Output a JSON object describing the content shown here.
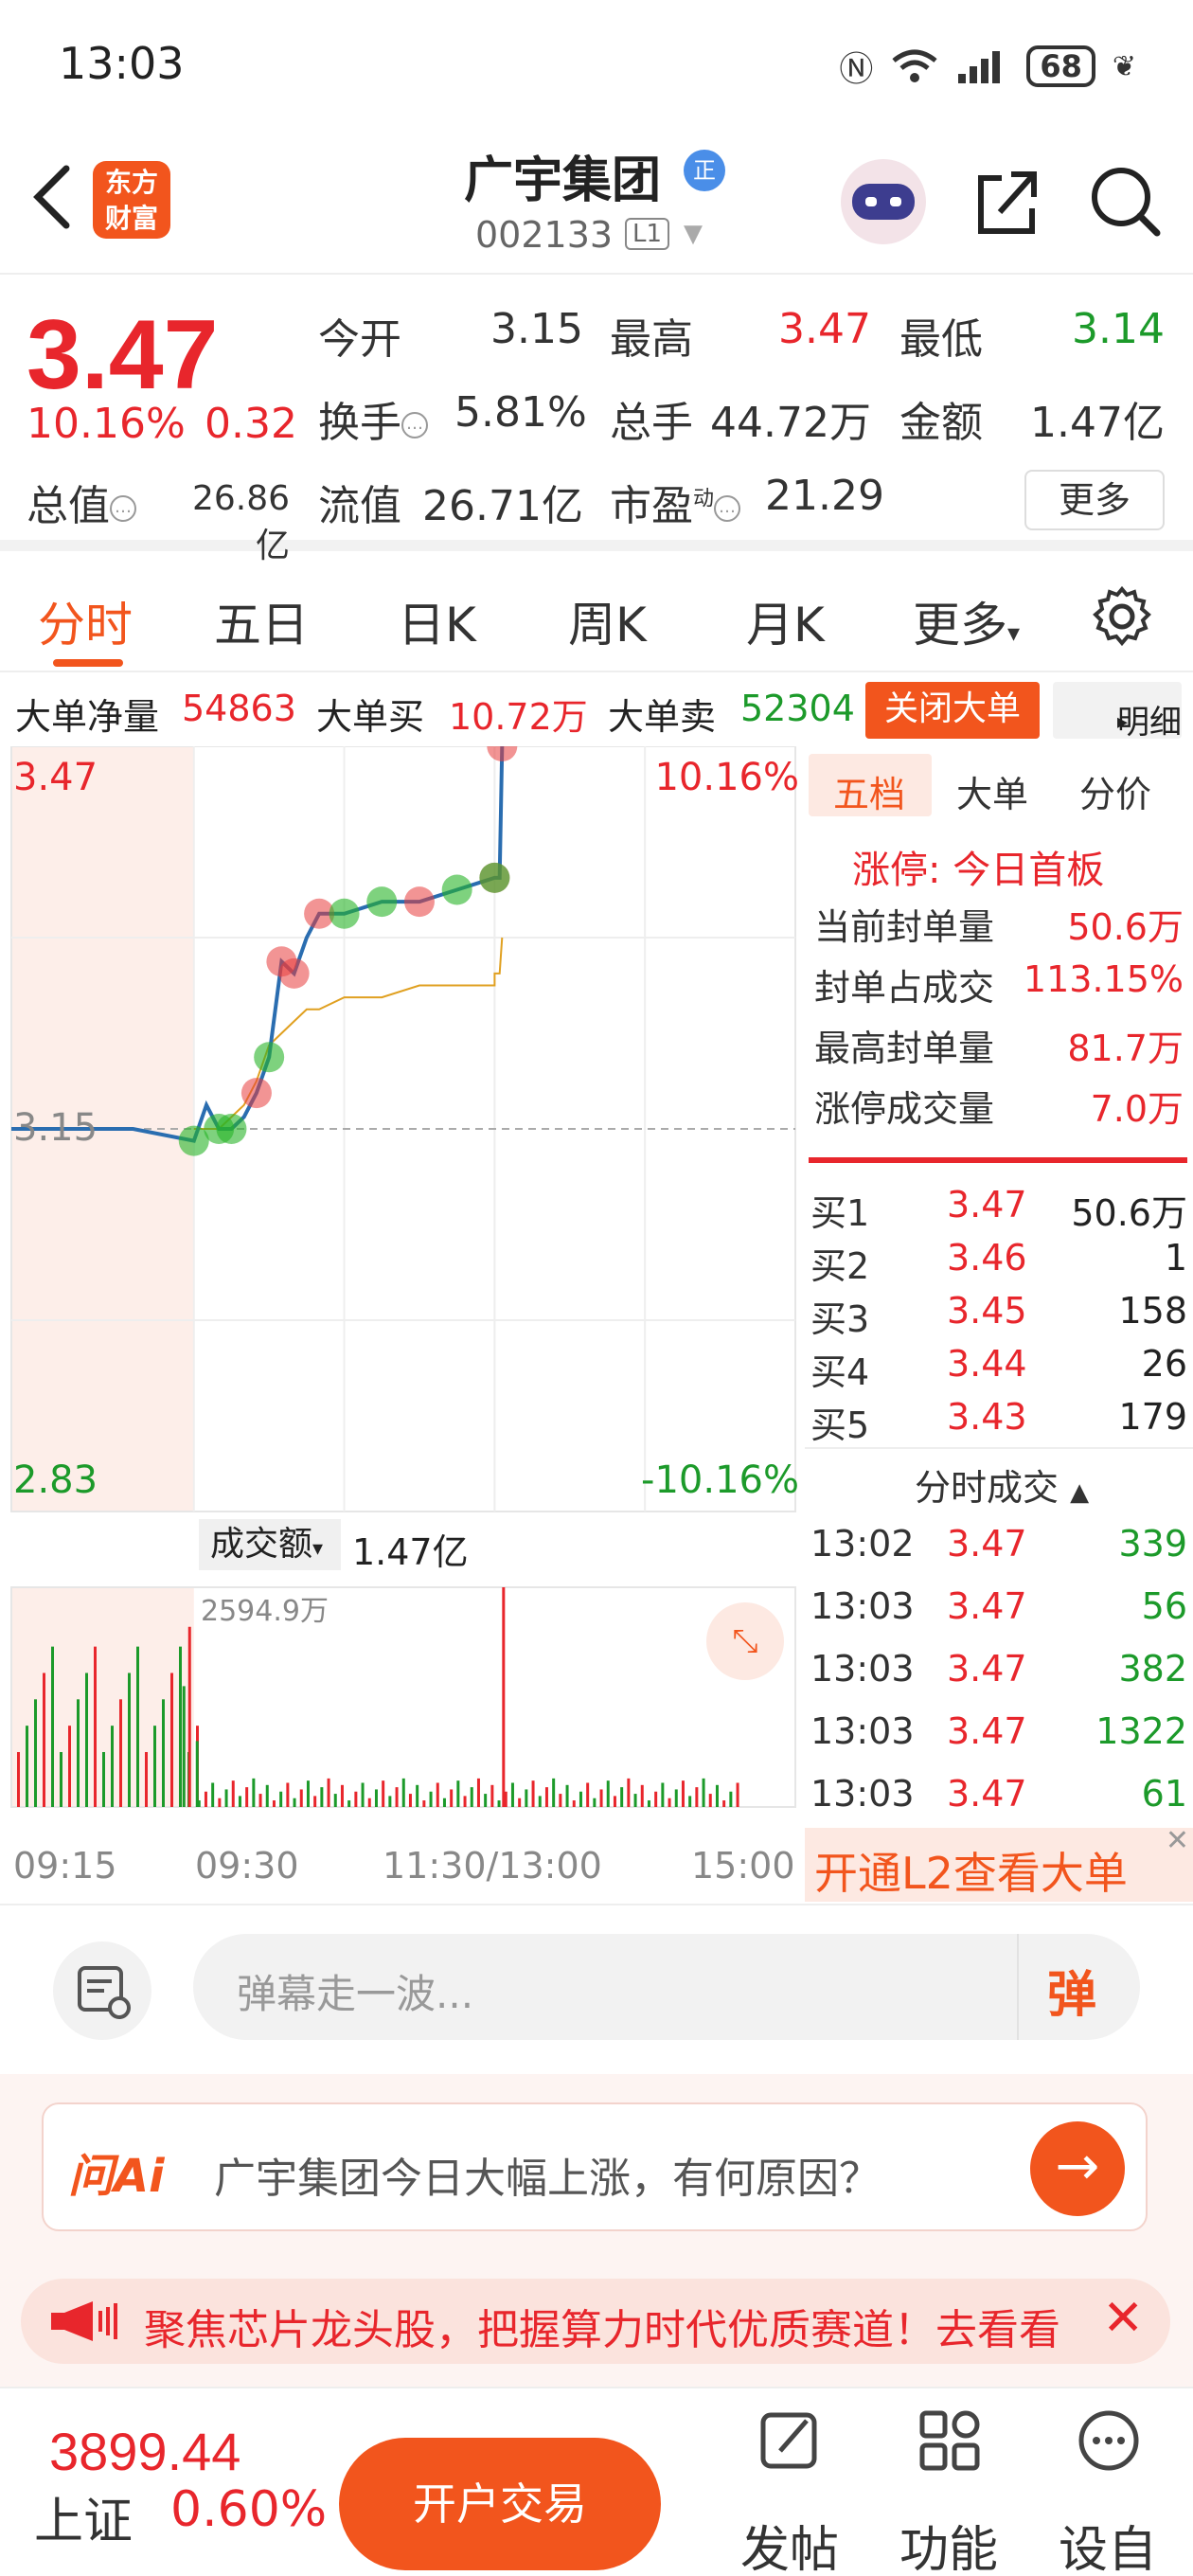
{
  "status_bar": {
    "time": "13:03",
    "battery": "68"
  },
  "header": {
    "logo_line1": "东方",
    "logo_line2": "财富",
    "stock_name": "广宇集团",
    "badge": "正",
    "code": "002133",
    "level": "L1"
  },
  "quote": {
    "price": "3.47",
    "pct": "10.16%",
    "change": "0.32",
    "open_label": "今开",
    "open": "3.15",
    "high_label": "最高",
    "high": "3.47",
    "low_label": "最低",
    "low": "3.14",
    "turnover_label": "换手",
    "turnover": "5.81%",
    "volume_label": "总手",
    "volume": "44.72万",
    "amount_label": "金额",
    "amount": "1.47亿",
    "mktcap_label": "总值",
    "mktcap": "26.86亿",
    "float_label": "流值",
    "float": "26.71亿",
    "pe_label": "市盈",
    "pe_sup": "动",
    "pe": "21.29",
    "more": "更多"
  },
  "tabs": [
    "分时",
    "五日",
    "日K",
    "周K",
    "月K",
    "更多"
  ],
  "big_order": {
    "net_label": "大单净量",
    "net": "54863",
    "buy_label": "大单买",
    "buy": "10.72万",
    "sell_label": "大单卖",
    "sell": "52304",
    "close_btn": "关闭大单",
    "detail_btn": "明细"
  },
  "chart": {
    "y_top": "3.47",
    "y_mid": "3.15",
    "y_bottom": "2.83",
    "pct_top": "10.16%",
    "pct_bottom": "-10.16%",
    "vol_selector": "成交额",
    "vol_total": "1.47亿",
    "vol_max": "2594.9万",
    "x_labels": [
      "09:15",
      "09:30",
      "11:30/13:00",
      "15:00"
    ]
  },
  "chart_data": {
    "type": "line",
    "title": "",
    "ylim": [
      2.83,
      3.47
    ],
    "reference": 3.15,
    "x": [
      "09:15",
      "09:25",
      "09:30",
      "09:35",
      "09:40",
      "09:45",
      "09:50",
      "09:55",
      "10:00",
      "10:05",
      "10:10",
      "10:15",
      "10:20",
      "10:30",
      "10:45",
      "11:00",
      "11:15",
      "11:30",
      "13:00",
      "13:02",
      "13:03"
    ],
    "series": [
      {
        "values": [
          3.15,
          3.15,
          3.14,
          3.17,
          3.15,
          3.15,
          3.16,
          3.18,
          3.21,
          3.29,
          3.28,
          3.31,
          3.33,
          3.33,
          3.34,
          3.34,
          3.35,
          3.36,
          3.36,
          3.36,
          3.47
        ]
      },
      {
        "values": [
          null,
          null,
          3.15,
          3.15,
          3.15,
          3.16,
          3.17,
          3.19,
          3.22,
          3.23,
          3.24,
          3.25,
          3.25,
          3.26,
          3.26,
          3.27,
          3.27,
          3.27,
          3.28,
          3.28,
          3.31
        ]
      }
    ],
    "volume_max": "2594.9万"
  },
  "panel": {
    "tabs": [
      "五档",
      "大单",
      "分价"
    ],
    "limit_title": "涨停: 今日首板",
    "stats": [
      {
        "label": "当前封单量",
        "value": "50.6万"
      },
      {
        "label": "封单占成交",
        "value": "113.15%"
      },
      {
        "label": "最高封单量",
        "value": "81.7万"
      },
      {
        "label": "涨停成交量",
        "value": "7.0万"
      }
    ],
    "bids": [
      {
        "label": "买1",
        "price": "3.47",
        "vol": "50.6万"
      },
      {
        "label": "买2",
        "price": "3.46",
        "vol": "1"
      },
      {
        "label": "买3",
        "price": "3.45",
        "vol": "158"
      },
      {
        "label": "买4",
        "price": "3.44",
        "vol": "26"
      },
      {
        "label": "买5",
        "price": "3.43",
        "vol": "179"
      }
    ],
    "ticks_title": "分时成交",
    "ticks": [
      {
        "time": "13:02",
        "price": "3.47",
        "vol": "339"
      },
      {
        "time": "13:03",
        "price": "3.47",
        "vol": "56"
      },
      {
        "time": "13:03",
        "price": "3.47",
        "vol": "382"
      },
      {
        "time": "13:03",
        "price": "3.47",
        "vol": "1322"
      },
      {
        "time": "13:03",
        "price": "3.47",
        "vol": "61"
      }
    ],
    "l2_banner": "开通L2查看大单"
  },
  "comment": {
    "placeholder": "弹幕走一波...",
    "btn": "弹"
  },
  "ai": {
    "logo": "问Ai",
    "question": "广宇集团今日大幅上涨，有何原因？",
    "promo": "聚焦芯片龙头股，把握算力时代优质赛道！去看看"
  },
  "bottom": {
    "index_value": "3899.44",
    "index_name": "上证",
    "index_pct": "0.60%",
    "open_btn": "开户交易",
    "nav": [
      "发帖",
      "功能",
      "设自选"
    ]
  },
  "colors": {
    "accent": "#f2551d",
    "up": "#e8262c",
    "down": "#1c9a2a",
    "line": "#2a6db0",
    "avg": "#e0a020"
  }
}
